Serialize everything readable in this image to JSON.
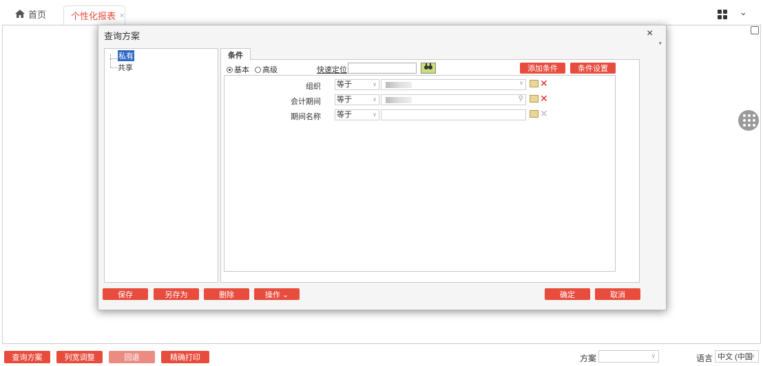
{
  "tabs": {
    "home_label": "首页",
    "active_label": "个性化报表",
    "active_close": "×"
  },
  "topbar": {
    "menu_chevron": "⌄"
  },
  "dialog": {
    "title": "查询方案",
    "close": "×",
    "collapse": "▾",
    "tree": {
      "private": "私有",
      "shared": "共享"
    },
    "tab_label": "条件",
    "mode_basic": "基本",
    "mode_advanced": "高级",
    "quick_locate_label": "快速定位",
    "quick_locate_value": "",
    "find_icon": "🔍",
    "add_condition": "添加条件",
    "condition_settings": "条件设置",
    "conditions": [
      {
        "label": "组织",
        "operator": "等于",
        "value_type": "dropdown"
      },
      {
        "label": "会计期间",
        "operator": "等于",
        "value_type": "search"
      },
      {
        "label": "期间名称",
        "operator": "等于",
        "value_type": "text"
      }
    ],
    "buttons": {
      "save": "保存",
      "save_as": "另存为",
      "delete": "删除",
      "operate": "操作 ⌄",
      "confirm": "确定",
      "cancel": "取消"
    }
  },
  "bottom": {
    "query_plan": "查询方案",
    "column_width": "列宽调整",
    "back": "回退",
    "precise_print": "精确打印",
    "plan_label": "方案",
    "plan_value": "",
    "lang_label": "语言",
    "lang_value": "中文 (中国"
  },
  "colors": {
    "accent": "#e84c3d",
    "accent_disabled": "#eb8c82"
  }
}
